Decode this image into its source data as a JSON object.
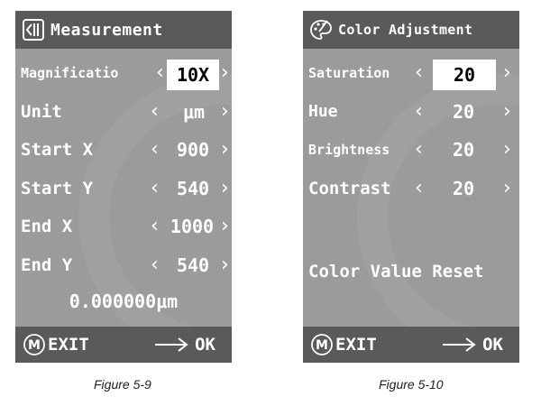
{
  "measurement": {
    "title": "Measurement",
    "rows": [
      {
        "label": "Magnificatio",
        "value": "10X"
      },
      {
        "label": "Unit",
        "value": "μm"
      },
      {
        "label": "Start X",
        "value": "900"
      },
      {
        "label": "Start Y",
        "value": "540"
      },
      {
        "label": "End X",
        "value": "1000"
      },
      {
        "label": "End Y",
        "value": "540"
      }
    ],
    "result": "0.000000μm",
    "exit_label": "EXIT",
    "ok_label": "OK",
    "selected_row": "Magnification"
  },
  "color_adjustment": {
    "title": "Color Adjustment",
    "rows": [
      {
        "label": "Saturation",
        "value": "20"
      },
      {
        "label": "Hue",
        "value": "20"
      },
      {
        "label": "Brightness",
        "value": "20"
      },
      {
        "label": "Contrast",
        "value": "20"
      }
    ],
    "reset_label": "Color Value Reset",
    "exit_label": "EXIT",
    "ok_label": "OK",
    "selected_row": "Saturation"
  },
  "captions": {
    "left": "Figure 5-9",
    "right": "Figure 5-10"
  },
  "icons": {
    "measurement_title": "measurement-icon",
    "color_title": "palette-icon",
    "left_arrow": "chevron-left-icon",
    "right_arrow": "chevron-right-icon",
    "menu_button": "m-circle-icon",
    "ok_arrow": "long-arrow-right-icon"
  },
  "colors": {
    "panel": "#9b9b9b",
    "bar": "#5a5a5a",
    "text": "#ffffff",
    "selected_value_bg": "#ffffff"
  }
}
